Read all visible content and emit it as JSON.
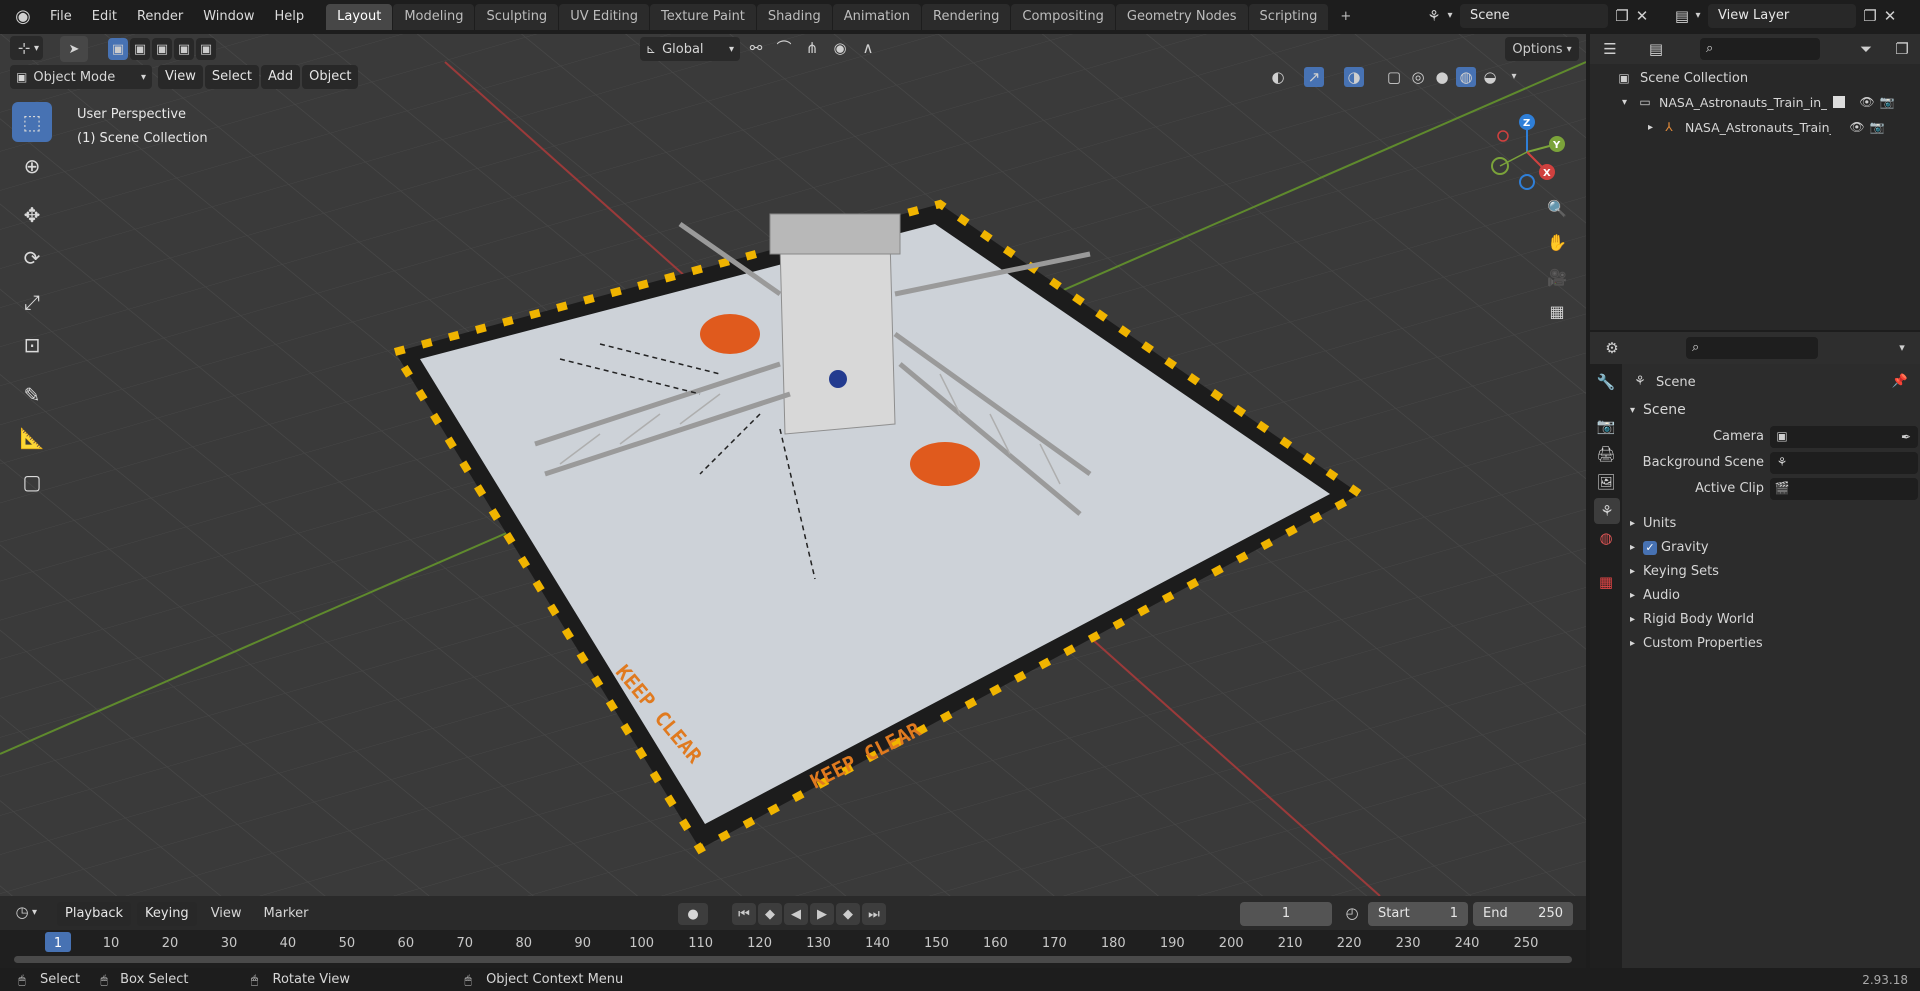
{
  "menu": {
    "items": [
      "File",
      "Edit",
      "Render",
      "Window",
      "Help"
    ]
  },
  "workspaces": [
    "Layout",
    "Modeling",
    "Sculpting",
    "UV Editing",
    "Texture Paint",
    "Shading",
    "Animation",
    "Rendering",
    "Compositing",
    "Geometry Nodes",
    "Scripting"
  ],
  "active_workspace": "Layout",
  "scene_field": "Scene",
  "view_layer_field": "View Layer",
  "viewport_header": {
    "transform_orientation": "Global",
    "options_label": "Options",
    "mode": "Object Mode",
    "menus": [
      "View",
      "Select",
      "Add",
      "Object"
    ]
  },
  "viewport_overlay": {
    "perspective": "User Perspective",
    "collection": "(1) Scene Collection"
  },
  "gizmo": {
    "z": "Z",
    "y": "Y",
    "x": "X"
  },
  "outliner": {
    "root": "Scene Collection",
    "items": [
      {
        "label": "NASA_Astronauts_Train_in_th"
      },
      {
        "label": "NASA_Astronauts_Train_"
      }
    ]
  },
  "properties": {
    "context": "Scene",
    "panel_title": "Scene",
    "fields": [
      {
        "label": "Camera"
      },
      {
        "label": "Background Scene"
      },
      {
        "label": "Active Clip"
      }
    ],
    "sections": [
      "Units",
      "Gravity",
      "Keying Sets",
      "Audio",
      "Rigid Body World",
      "Custom Properties"
    ],
    "gravity_checked": true
  },
  "timeline": {
    "menus": [
      "Playback",
      "Keying",
      "View",
      "Marker"
    ],
    "current_frame": "1",
    "start_label": "Start",
    "start": "1",
    "end_label": "End",
    "end": "250",
    "ticks": [
      "1",
      "10",
      "20",
      "30",
      "40",
      "50",
      "60",
      "70",
      "80",
      "90",
      "100",
      "110",
      "120",
      "130",
      "140",
      "150",
      "160",
      "170",
      "180",
      "190",
      "200",
      "210",
      "220",
      "230",
      "240",
      "250"
    ]
  },
  "status_bar": {
    "select": "Select",
    "box_select": "Box Select",
    "rotate_view": "Rotate View",
    "context_menu": "Object Context Menu",
    "version": "2.93.18"
  },
  "scene_texts": {
    "keep_clear_1": "KEEP CLEAR",
    "keep_clear_2": "KEEP CLEAR"
  },
  "colors": {
    "accent": "#4772b3",
    "x_axis": "#d0413f",
    "y_axis": "#7ba33a",
    "z_axis": "#2f7fd8",
    "mat_orange": "#e05a1d",
    "warning_yellow": "#f0b400"
  }
}
